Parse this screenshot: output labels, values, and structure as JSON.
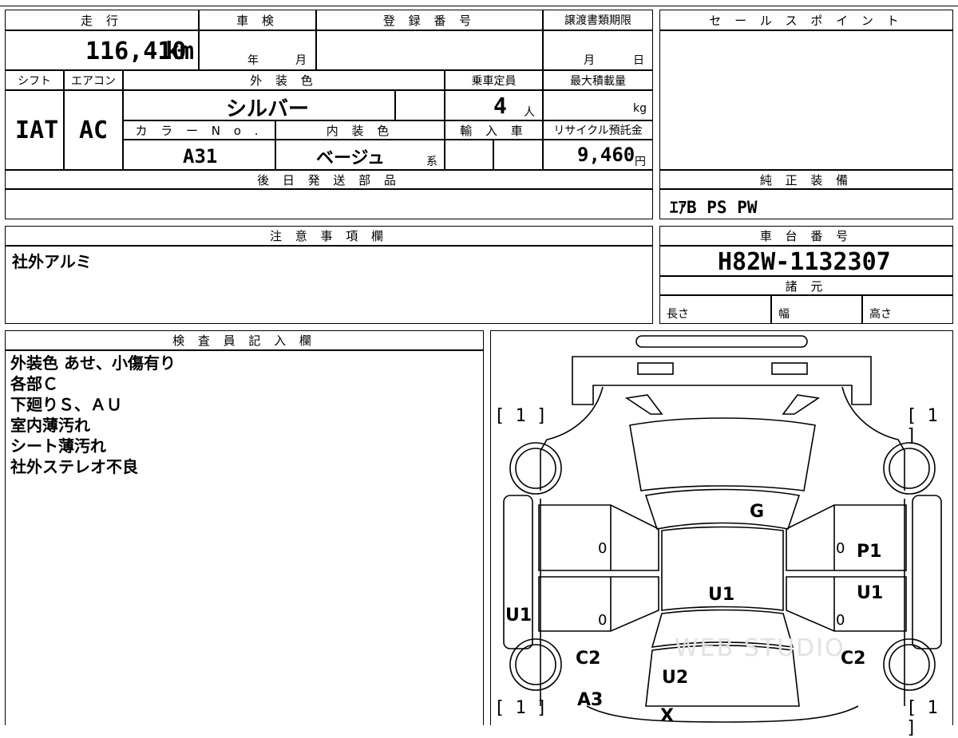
{
  "mileage": {
    "label": "走 行",
    "value": "116,410",
    "unit": "km"
  },
  "inspection": {
    "label": "車 検",
    "year": "年",
    "month": "月"
  },
  "registration_number": {
    "label": "登 録 番 号",
    "value": ""
  },
  "transfer_deadline": {
    "label": "譲渡書類期限",
    "month": "月",
    "day": "日"
  },
  "sales_point": {
    "label": "セ ー ル ス ポ イ ン ト",
    "value": ""
  },
  "shift": {
    "label": "シフト",
    "value": "IAT"
  },
  "aircon": {
    "label": "エアコン",
    "value": "AC"
  },
  "exterior_color": {
    "label": "外 装 色",
    "value": "シルバー"
  },
  "capacity": {
    "label": "乗車定員",
    "value": "4",
    "unit": "人"
  },
  "max_load": {
    "label": "最大積載量",
    "unit": "kg"
  },
  "color_no": {
    "label": "カ ラ ー N o .",
    "value": "A31"
  },
  "interior_color": {
    "label": "内 装 色",
    "value": "ベージュ",
    "suffix": "系"
  },
  "import": {
    "label": "輸 入 車"
  },
  "recycle_fee": {
    "label": "リサイクル預託金",
    "value": "9,460",
    "unit": "円"
  },
  "later_parts": {
    "label": "後 日 発 送 部 品",
    "value": ""
  },
  "standard_equipment": {
    "label": "純 正 装 備",
    "value": "ｴｱB PS PW"
  },
  "caution": {
    "label": "注 意 事 項 欄",
    "value": "社外アルミ"
  },
  "chassis_number": {
    "label": "車 台 番 号",
    "value": "H82W-1132307"
  },
  "specs": {
    "label": "諸 元",
    "length": "長さ",
    "width": "幅",
    "height": "高さ"
  },
  "inspector": {
    "label": "検 査 員 記 入 欄",
    "lines": [
      "外装色 あせ、小傷有り",
      "各部Ｃ",
      "下廻りＳ、ＡＵ",
      "室内薄汚れ",
      "シート薄汚れ",
      "社外ステレオ不良"
    ]
  },
  "diagram": {
    "tire_fl": "[ 1 ]",
    "tire_fr": "[ 1 ]",
    "tire_rl": "[ 1 ]",
    "tire_rr": "[ 1 ]",
    "marks": {
      "hood": "G",
      "front_door_left": "0",
      "front_door_right": "0",
      "fender_right": "P1",
      "roof": "U1",
      "rear_door_right_mark": "U1",
      "side_left": "U1",
      "rear_door_left": "0",
      "rear_door_right": "0",
      "quarter_left": "C2",
      "quarter_right": "C2",
      "trunk": "U2",
      "rear_left": "A3",
      "rear_bumper": "X"
    },
    "watermark": "WEB STUDIO"
  }
}
